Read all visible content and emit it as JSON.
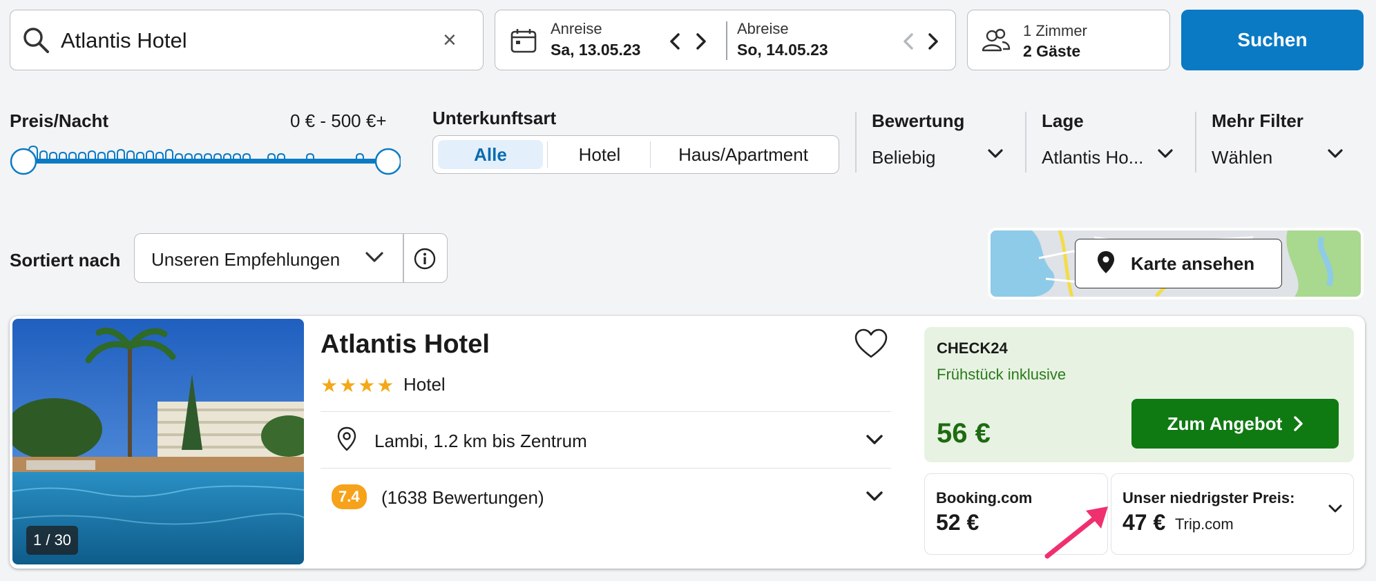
{
  "search": {
    "query": "Atlantis Hotel",
    "clear_icon": "×"
  },
  "dates": {
    "checkin_label": "Anreise",
    "checkin_value": "Sa, 13.05.23",
    "checkout_label": "Abreise",
    "checkout_value": "So, 14.05.23"
  },
  "guests": {
    "rooms": "1 Zimmer",
    "guests": "2 Gäste"
  },
  "search_button": "Suchen",
  "filters": {
    "price": {
      "title": "Preis/Nacht",
      "range": "0 € - 500 €+",
      "min_fraction": 0,
      "max_fraction": 1
    },
    "type": {
      "title": "Unterkunftsart",
      "options": [
        "Alle",
        "Hotel",
        "Haus/Apartment"
      ],
      "selected": "Alle"
    },
    "rating": {
      "title": "Bewertung",
      "value": "Beliebig"
    },
    "location": {
      "title": "Lage",
      "value": "Atlantis Ho..."
    },
    "more": {
      "title": "Mehr Filter",
      "value": "Wählen"
    }
  },
  "sort": {
    "label": "Sortiert nach",
    "value": "Unseren Empfehlungen"
  },
  "map": {
    "button_label": "Karte ansehen"
  },
  "hotel": {
    "name": "Atlantis Hotel",
    "stars": 4,
    "stars_text": "★★★★",
    "type": "Hotel",
    "photo_counter": "1 / 30",
    "location": "Lambi, 1.2 km bis Zentrum",
    "rating_score": "7.4",
    "rating_count": "(1638 Bewertungen)",
    "main_offer": {
      "provider": "CHECK24",
      "extra": "Frühstück inklusive",
      "price": "56 €",
      "button": "Zum Angebot"
    },
    "offer_2": {
      "provider": "Booking.com",
      "price": "52 €"
    },
    "offer_3": {
      "label": "Unser niedrigster Preis:",
      "price": "47 €",
      "provider": "Trip.com"
    }
  },
  "colors": {
    "primary_blue": "#0a7ac4",
    "green_button": "#0f7a12",
    "green_price": "#1f6b10",
    "offer_bg": "#e7f2e3",
    "rating_badge": "#f7a21b",
    "star": "#f4a817",
    "annotation_arrow": "#f0306e"
  }
}
